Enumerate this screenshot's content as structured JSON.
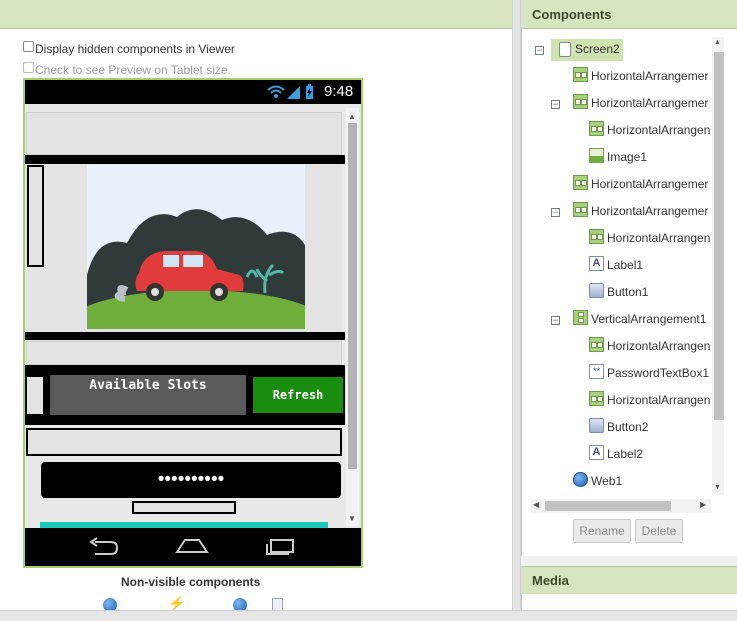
{
  "viewer": {
    "display_hidden_label": "Display hidden components in Viewer",
    "tablet_preview_label": "Check to see Preview on Tablet size.",
    "nonvisible_title": "Non-visible components"
  },
  "phone": {
    "clock": "9:48",
    "available_slots_label": "Available Slots",
    "refresh_label": "Refresh",
    "password_value": "••••••••••",
    "colors": {
      "refresh_green": "#178c0f",
      "slots_gray": "#5a5a5a",
      "accent_teal": "#1ec8b4",
      "frame_green": "#a6cf6a"
    },
    "icons": [
      "wifi-icon",
      "signal-icon",
      "battery-icon",
      "back-icon",
      "home-icon",
      "recents-icon"
    ]
  },
  "components": {
    "title": "Components",
    "tree": [
      {
        "label": "Screen2",
        "icon": "screen-icon",
        "collapsible": true,
        "selected": true
      },
      {
        "label": "HorizontalArrangemer",
        "icon": "horizontal-arrangement-icon"
      },
      {
        "label": "HorizontalArrangemer",
        "icon": "horizontal-arrangement-icon",
        "collapsible": true
      },
      {
        "label": "HorizontalArrangen",
        "icon": "horizontal-arrangement-icon"
      },
      {
        "label": "Image1",
        "icon": "image-icon"
      },
      {
        "label": "HorizontalArrangemer",
        "icon": "horizontal-arrangement-icon"
      },
      {
        "label": "HorizontalArrangemer",
        "icon": "horizontal-arrangement-icon",
        "collapsible": true
      },
      {
        "label": "HorizontalArrangen",
        "icon": "horizontal-arrangement-icon"
      },
      {
        "label": "Label1",
        "icon": "label-icon"
      },
      {
        "label": "Button1",
        "icon": "button-icon"
      },
      {
        "label": "VerticalArrangement1",
        "icon": "vertical-arrangement-icon",
        "collapsible": true
      },
      {
        "label": "HorizontalArrangen",
        "icon": "horizontal-arrangement-icon"
      },
      {
        "label": "PasswordTextBox1",
        "icon": "password-icon"
      },
      {
        "label": "HorizontalArrangen",
        "icon": "horizontal-arrangement-icon"
      },
      {
        "label": "Button2",
        "icon": "button-icon"
      },
      {
        "label": "Label2",
        "icon": "label-icon"
      },
      {
        "label": "Web1",
        "icon": "web-icon"
      }
    ],
    "rename_label": "Rename",
    "delete_label": "Delete"
  },
  "media": {
    "title": "Media"
  }
}
